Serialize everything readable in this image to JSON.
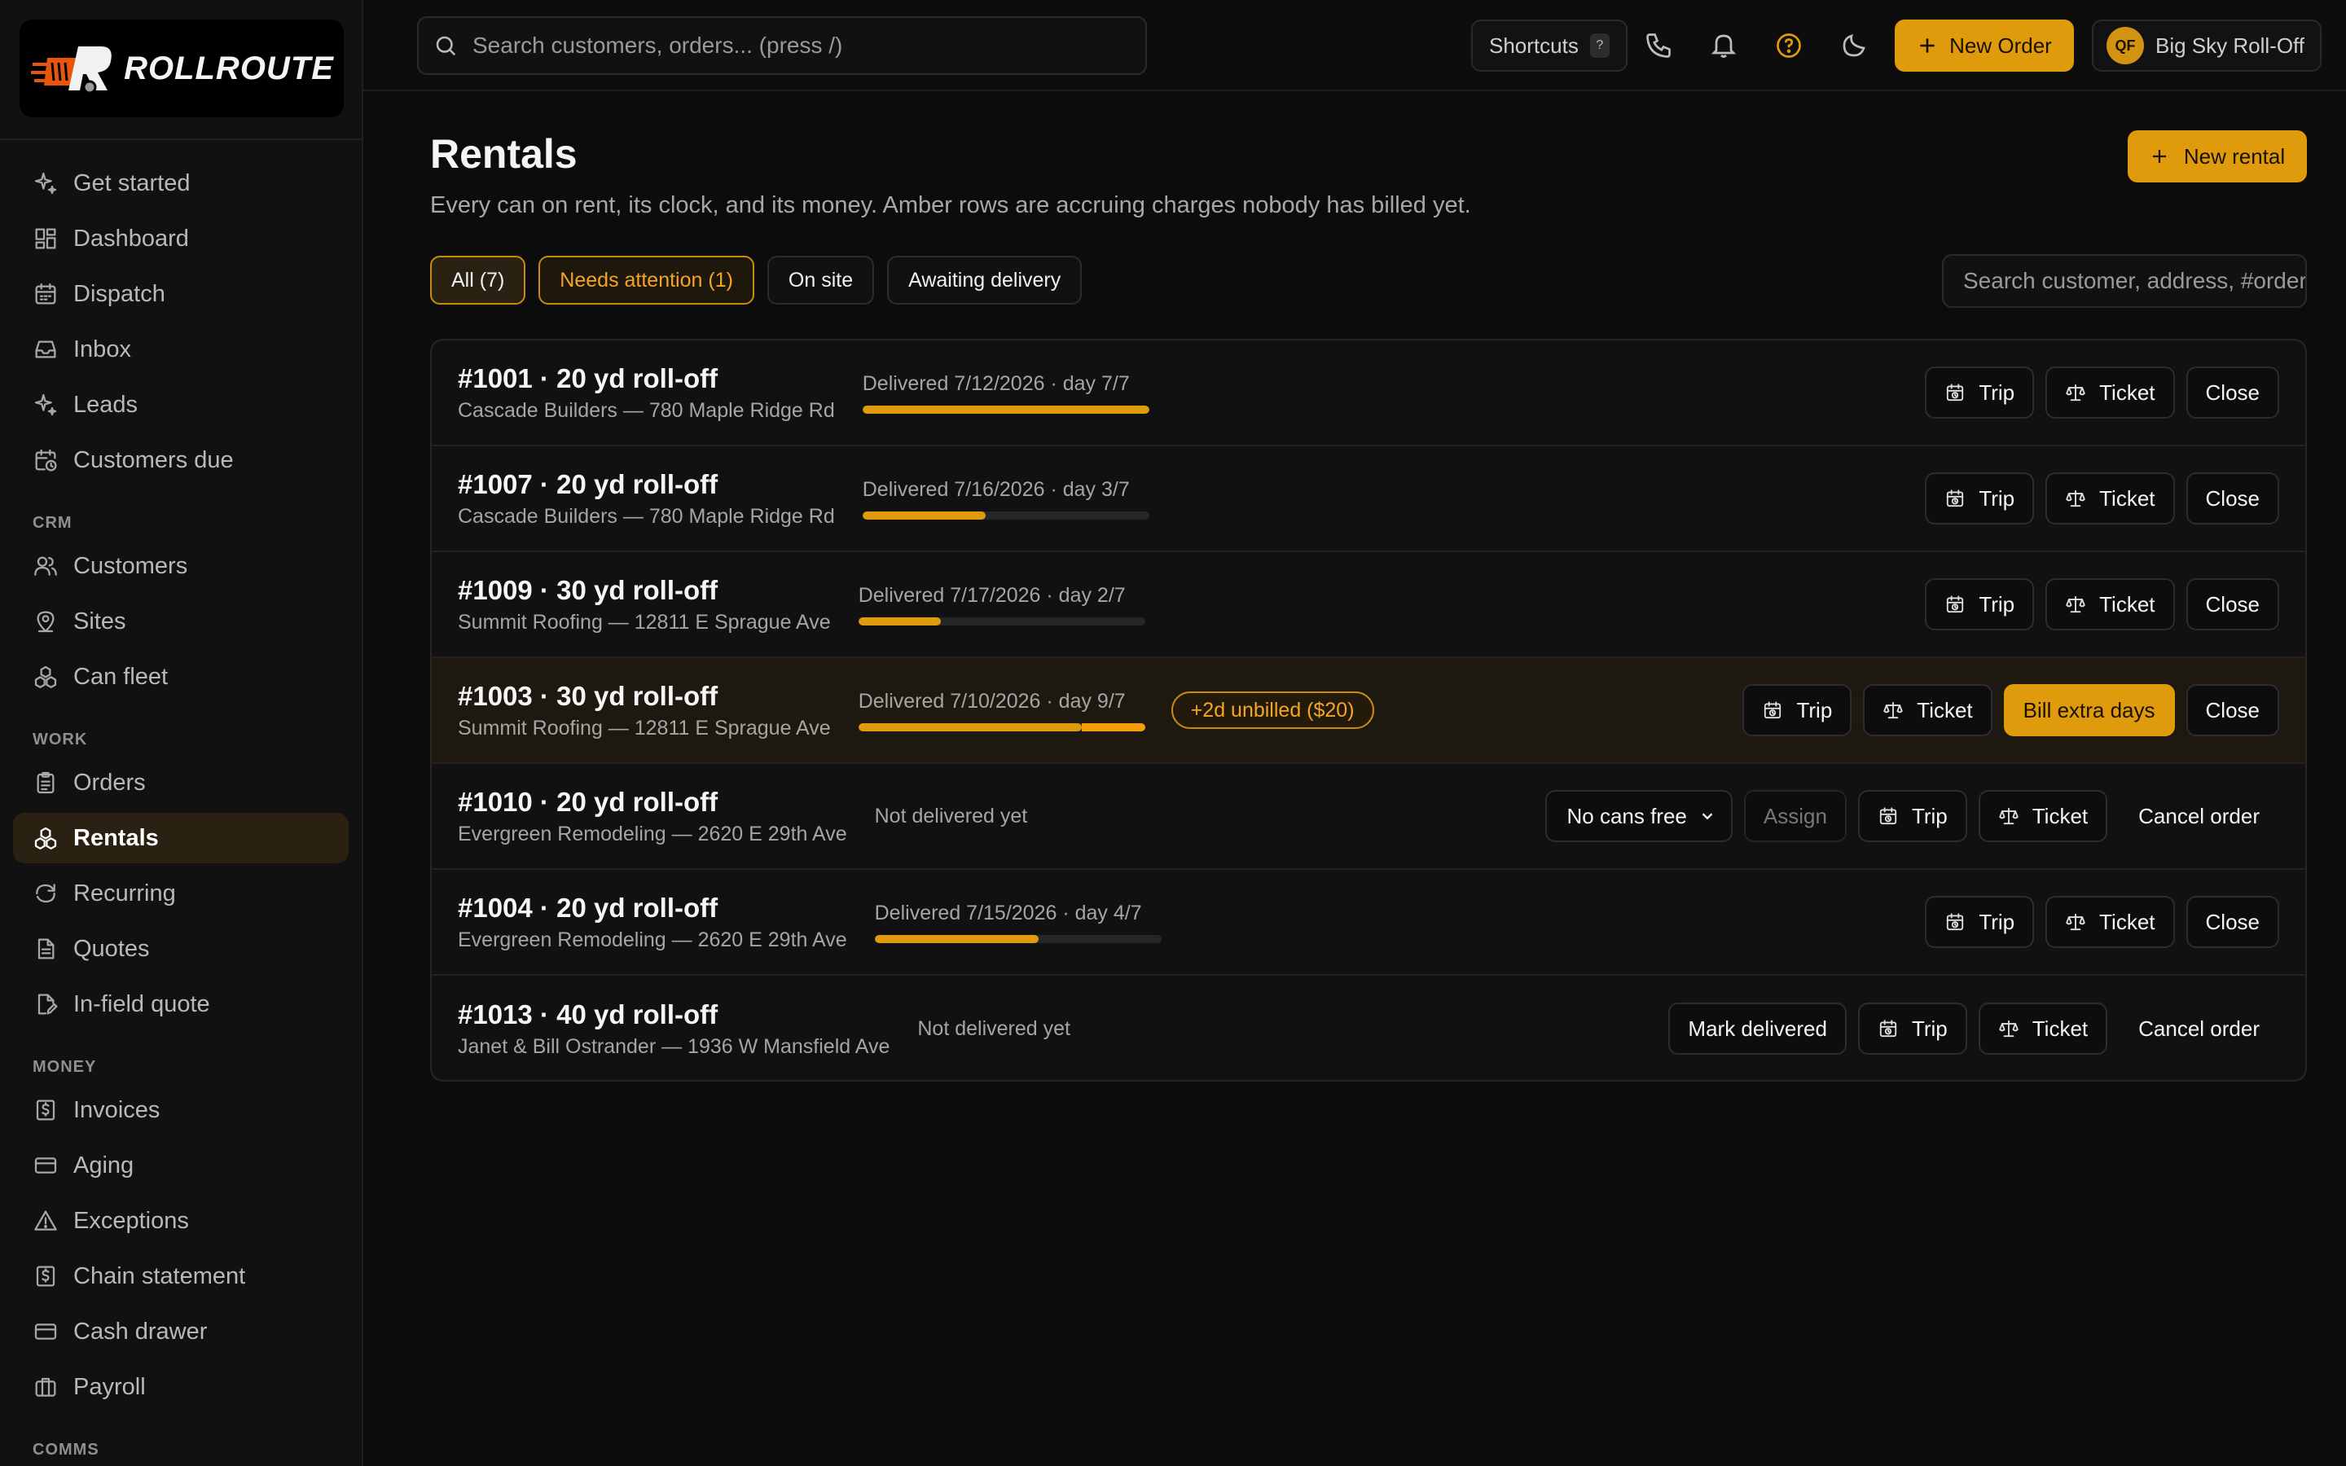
{
  "brand": {
    "name": "ROLLROUTE",
    "accent": "#e09b0c"
  },
  "sidebar": {
    "items_top": [
      {
        "label": "Get started",
        "icon": "sparkles-icon"
      },
      {
        "label": "Dashboard",
        "icon": "dashboard-icon"
      },
      {
        "label": "Dispatch",
        "icon": "calendar-icon"
      },
      {
        "label": "Inbox",
        "icon": "inbox-icon"
      },
      {
        "label": "Leads",
        "icon": "sparkles-icon"
      },
      {
        "label": "Customers due",
        "icon": "calendar-clock-icon"
      }
    ],
    "section_crm": "CRM",
    "items_crm": [
      {
        "label": "Customers",
        "icon": "users-icon"
      },
      {
        "label": "Sites",
        "icon": "map-pin-icon"
      },
      {
        "label": "Can fleet",
        "icon": "boxes-icon"
      }
    ],
    "section_work": "WORK",
    "items_work": [
      {
        "label": "Orders",
        "icon": "clipboard-icon"
      },
      {
        "label": "Rentals",
        "icon": "boxes-icon",
        "active": true
      },
      {
        "label": "Recurring",
        "icon": "refresh-icon"
      },
      {
        "label": "Quotes",
        "icon": "document-icon"
      },
      {
        "label": "In-field quote",
        "icon": "document-edit-icon"
      }
    ],
    "section_money": "MONEY",
    "items_money": [
      {
        "label": "Invoices",
        "icon": "receipt-icon"
      },
      {
        "label": "Aging",
        "icon": "credit-card-icon"
      },
      {
        "label": "Exceptions",
        "icon": "warning-icon"
      },
      {
        "label": "Chain statement",
        "icon": "receipt-icon"
      },
      {
        "label": "Cash drawer",
        "icon": "credit-card-icon"
      },
      {
        "label": "Payroll",
        "icon": "briefcase-icon"
      }
    ],
    "section_comms": "COMMS"
  },
  "topbar": {
    "search_placeholder": "Search customers, orders... (press /)",
    "shortcuts_label": "Shortcuts",
    "shortcuts_key": "?",
    "new_order_label": "New Order",
    "account_initials": "QF",
    "account_name": "Big Sky Roll-Off"
  },
  "page": {
    "title": "Rentals",
    "subtitle": "Every can on rent, its clock, and its money. Amber rows are accruing charges nobody has billed yet.",
    "new_rental_label": "New rental",
    "filters": [
      {
        "label": "All (7)",
        "state": "active"
      },
      {
        "label": "Needs attention (1)",
        "state": "warn"
      },
      {
        "label": "On site",
        "state": ""
      },
      {
        "label": "Awaiting delivery",
        "state": ""
      }
    ],
    "search_placeholder": "Search customer, address, #order"
  },
  "rentals": [
    {
      "title": "#1001 · 20 yd roll-off",
      "address": "Cascade Builders — 780 Maple Ridge Rd",
      "status": "Delivered 7/12/2026 · day 7/7",
      "progress": 1.0,
      "overage": 0,
      "badge": "",
      "attention": false,
      "actions": [
        {
          "label": "Trip",
          "icon": "trip-icon",
          "style": ""
        },
        {
          "label": "Ticket",
          "icon": "scale-icon",
          "style": ""
        },
        {
          "label": "Close",
          "icon": "",
          "style": ""
        }
      ]
    },
    {
      "title": "#1007 · 20 yd roll-off",
      "address": "Cascade Builders — 780 Maple Ridge Rd",
      "status": "Delivered 7/16/2026 · day 3/7",
      "progress": 0.4286,
      "overage": 0,
      "badge": "",
      "attention": false,
      "actions": [
        {
          "label": "Trip",
          "icon": "trip-icon",
          "style": ""
        },
        {
          "label": "Ticket",
          "icon": "scale-icon",
          "style": ""
        },
        {
          "label": "Close",
          "icon": "",
          "style": ""
        }
      ]
    },
    {
      "title": "#1009 · 30 yd roll-off",
      "address": "Summit Roofing — 12811 E Sprague Ave",
      "status": "Delivered 7/17/2026 · day 2/7",
      "progress": 0.2857,
      "overage": 0,
      "badge": "",
      "attention": false,
      "actions": [
        {
          "label": "Trip",
          "icon": "trip-icon",
          "style": ""
        },
        {
          "label": "Ticket",
          "icon": "scale-icon",
          "style": ""
        },
        {
          "label": "Close",
          "icon": "",
          "style": ""
        }
      ]
    },
    {
      "title": "#1003 · 30 yd roll-off",
      "address": "Summit Roofing — 12811 E Sprague Ave",
      "status": "Delivered 7/10/2026 · day 9/7",
      "progress": 0.7778,
      "overage": 0.2222,
      "badge": "+2d unbilled ($20)",
      "attention": true,
      "actions": [
        {
          "label": "Trip",
          "icon": "trip-icon",
          "style": ""
        },
        {
          "label": "Ticket",
          "icon": "scale-icon",
          "style": ""
        },
        {
          "label": "Bill extra days",
          "icon": "",
          "style": "primary"
        },
        {
          "label": "Close",
          "icon": "",
          "style": ""
        }
      ]
    },
    {
      "title": "#1010 · 20 yd roll-off",
      "address": "Evergreen Remodeling — 2620 E 29th Ave",
      "status": "Not delivered yet",
      "progress": null,
      "overage": 0,
      "badge": "",
      "attention": false,
      "select": "No cans free",
      "actions": [
        {
          "label": "Assign",
          "icon": "",
          "style": "disabled"
        },
        {
          "label": "Trip",
          "icon": "trip-icon",
          "style": ""
        },
        {
          "label": "Ticket",
          "icon": "scale-icon",
          "style": ""
        },
        {
          "label": "Cancel order",
          "icon": "",
          "style": "ghost"
        }
      ]
    },
    {
      "title": "#1004 · 20 yd roll-off",
      "address": "Evergreen Remodeling — 2620 E 29th Ave",
      "status": "Delivered 7/15/2026 · day 4/7",
      "progress": 0.5714,
      "overage": 0,
      "badge": "",
      "attention": false,
      "actions": [
        {
          "label": "Trip",
          "icon": "trip-icon",
          "style": ""
        },
        {
          "label": "Ticket",
          "icon": "scale-icon",
          "style": ""
        },
        {
          "label": "Close",
          "icon": "",
          "style": ""
        }
      ]
    },
    {
      "title": "#1013 · 40 yd roll-off",
      "address": "Janet & Bill Ostrander — 1936 W Mansfield Ave",
      "status": "Not delivered yet",
      "progress": null,
      "overage": 0,
      "badge": "",
      "attention": false,
      "actions": [
        {
          "label": "Mark delivered",
          "icon": "",
          "style": ""
        },
        {
          "label": "Trip",
          "icon": "trip-icon",
          "style": ""
        },
        {
          "label": "Ticket",
          "icon": "scale-icon",
          "style": ""
        },
        {
          "label": "Cancel order",
          "icon": "",
          "style": "ghost"
        }
      ]
    }
  ]
}
